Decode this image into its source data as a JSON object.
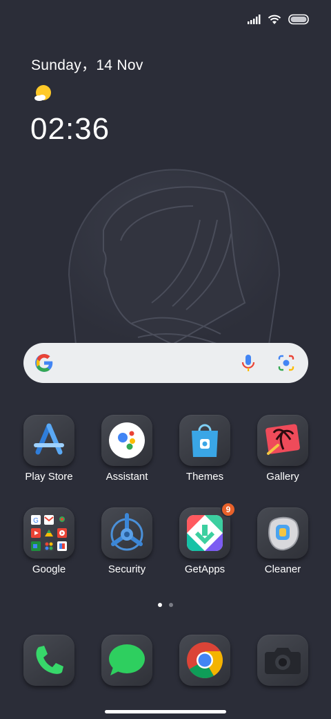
{
  "status_bar": {
    "icons": [
      "signal-icon",
      "wifi-icon",
      "battery-icon"
    ]
  },
  "clock_widget": {
    "date": "Sunday，14 Nov",
    "weather_icon": "sun-cloud-icon",
    "time": "02:36"
  },
  "search": {
    "icons": [
      "google-g-icon",
      "microphone-icon",
      "lens-icon"
    ]
  },
  "apps": [
    {
      "label": "Play Store",
      "icon": "play-store-icon"
    },
    {
      "label": "Assistant",
      "icon": "assistant-icon"
    },
    {
      "label": "Themes",
      "icon": "themes-icon"
    },
    {
      "label": "Gallery",
      "icon": "gallery-icon"
    },
    {
      "label": "Google",
      "icon": "google-folder-icon"
    },
    {
      "label": "Security",
      "icon": "security-icon"
    },
    {
      "label": "GetApps",
      "icon": "getapps-icon",
      "badge": "9"
    },
    {
      "label": "Cleaner",
      "icon": "cleaner-icon"
    }
  ],
  "page_indicator": {
    "count": 2,
    "active": 0
  },
  "dock": [
    {
      "icon": "phone-icon"
    },
    {
      "icon": "messages-icon"
    },
    {
      "icon": "chrome-icon"
    },
    {
      "icon": "camera-icon"
    }
  ],
  "colors": {
    "background": "#2b2d38",
    "badge": "#e8612a",
    "search_bg": "#eceef0"
  }
}
